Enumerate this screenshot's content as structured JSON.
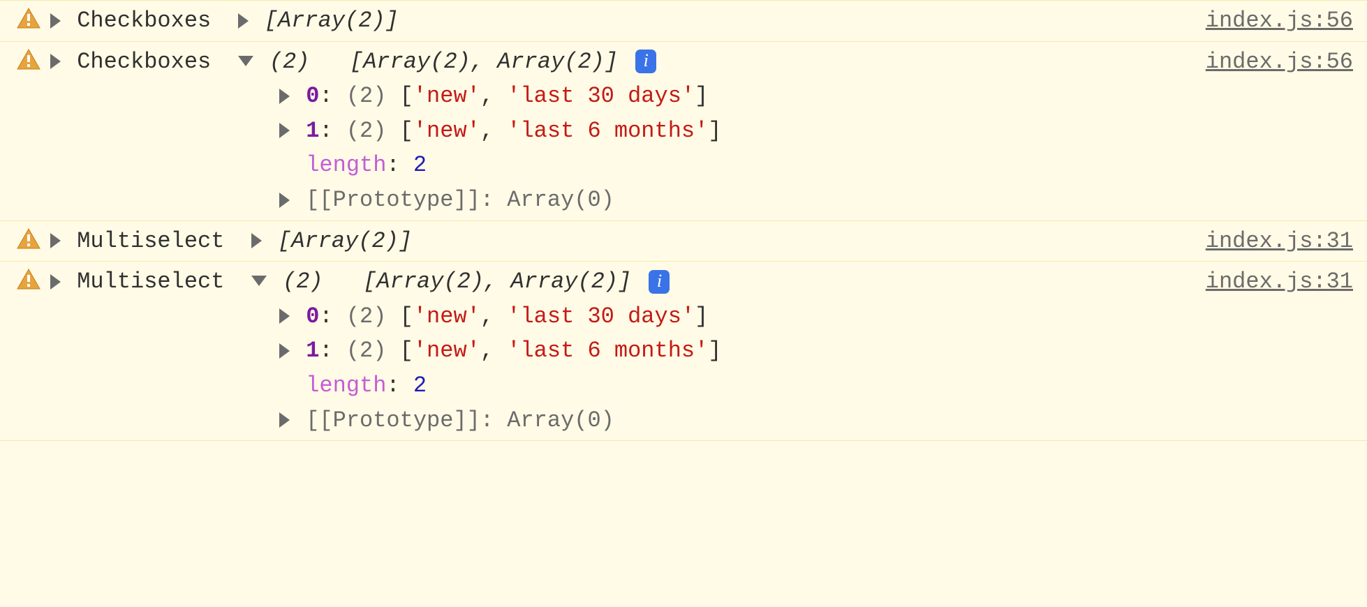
{
  "rows": [
    {
      "label": "Checkboxes",
      "summary_italic": "[Array(2)]",
      "source": "index.js:56",
      "expanded": false
    },
    {
      "label": "Checkboxes",
      "summary_prefix": "(2)",
      "summary_body": "[Array(2), Array(2)]",
      "source": "index.js:56",
      "expanded": true,
      "items": [
        {
          "idx": "0",
          "count": "(2)",
          "open": "[",
          "a": "'new'",
          "sep": ", ",
          "b": "'last 30 days'",
          "close": "]"
        },
        {
          "idx": "1",
          "count": "(2)",
          "open": "[",
          "a": "'new'",
          "sep": ", ",
          "b": "'last 6 months'",
          "close": "]"
        }
      ],
      "length_key": "length",
      "length_val": "2",
      "proto_key": "[[Prototype]]",
      "proto_val": "Array(0)"
    },
    {
      "label": "Multiselect",
      "summary_italic": "[Array(2)]",
      "source": "index.js:31",
      "expanded": false
    },
    {
      "label": "Multiselect",
      "summary_prefix": "(2)",
      "summary_body": "[Array(2), Array(2)]",
      "source": "index.js:31",
      "expanded": true,
      "items": [
        {
          "idx": "0",
          "count": "(2)",
          "open": "[",
          "a": "'new'",
          "sep": ", ",
          "b": "'last 30 days'",
          "close": "]"
        },
        {
          "idx": "1",
          "count": "(2)",
          "open": "[",
          "a": "'new'",
          "sep": ", ",
          "b": "'last 6 months'",
          "close": "]"
        }
      ],
      "length_key": "length",
      "length_val": "2",
      "proto_key": "[[Prototype]]",
      "proto_val": "Array(0)"
    }
  ],
  "info_glyph": "i",
  "punct": {
    "colon": ": "
  }
}
